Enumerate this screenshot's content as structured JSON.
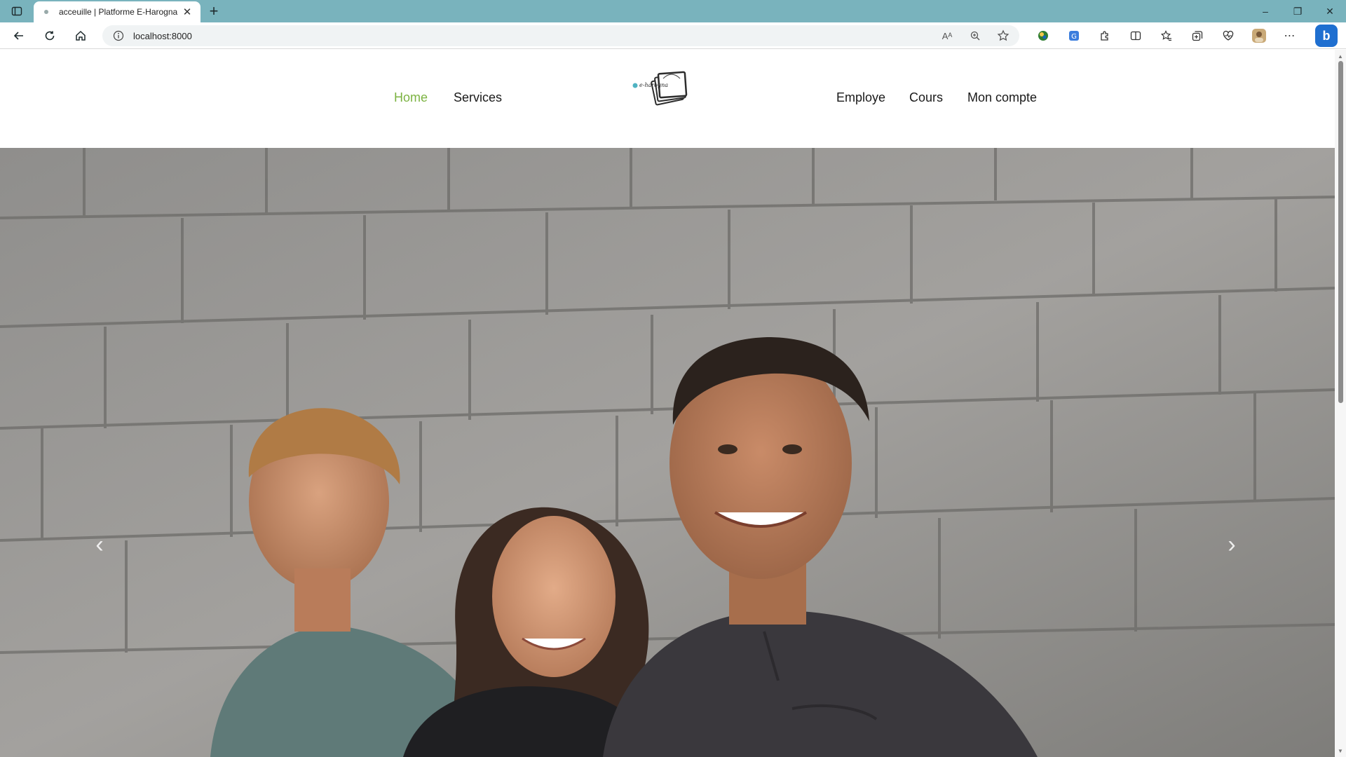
{
  "browser": {
    "tab_title": "acceuille | Platforme E-Harogna",
    "new_tab_symbol": "+",
    "url": "localhost:8000",
    "read_aloud_label": "Aᴬ",
    "window_controls": [
      "–",
      "❐",
      "✕"
    ]
  },
  "site": {
    "menu_left": [
      "Home",
      "Services"
    ],
    "menu_right": [
      "Employe",
      "Cours",
      "Mon compte"
    ],
    "logo_text": "e-harogna",
    "active_color": "#7cb342"
  },
  "carousel": {
    "prev_symbol": "‹",
    "next_symbol": "›"
  }
}
